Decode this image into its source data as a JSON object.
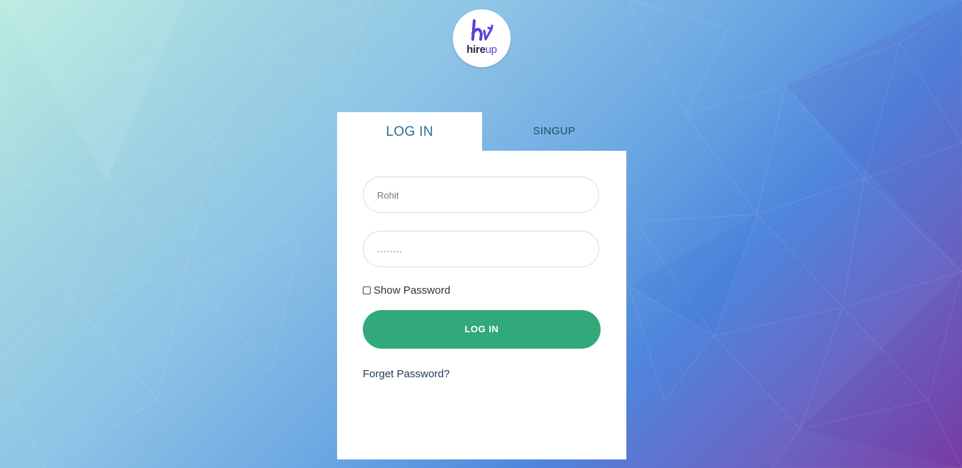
{
  "logo": {
    "brand_main": "hire",
    "brand_accent": "up",
    "accent_color": "#5b3fd6"
  },
  "tabs": [
    {
      "label": "LOG IN",
      "active": true
    },
    {
      "label": "SINGUP",
      "active": false
    }
  ],
  "form": {
    "username_value": "Rohit",
    "password_value": "․․․․․․․․",
    "show_password_label": "Show Password",
    "show_password_checked": false,
    "submit_label": "LOG IN",
    "forgot_label": "Forget Password?"
  },
  "colors": {
    "primary_button": "#31a97b",
    "tab_active_text": "#2d6f92"
  }
}
